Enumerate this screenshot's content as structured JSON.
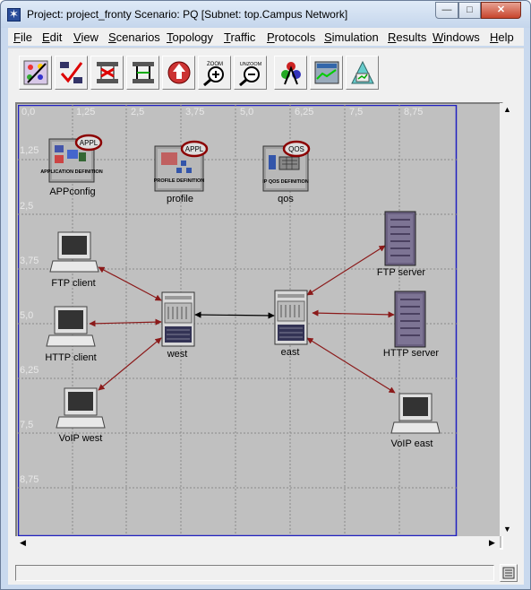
{
  "window": {
    "title": "Project: project_fronty Scenario: PQ  [Subnet: top.Campus Network]",
    "minimize_glyph": "—",
    "maximize_glyph": "□",
    "close_glyph": "✕"
  },
  "menu": [
    {
      "label": "File"
    },
    {
      "label": "Edit"
    },
    {
      "label": "View"
    },
    {
      "label": "Scenarios"
    },
    {
      "label": "Topology"
    },
    {
      "label": "Traffic"
    },
    {
      "label": "Protocols"
    },
    {
      "label": "Simulation"
    },
    {
      "label": "Results"
    },
    {
      "label": "Windows"
    },
    {
      "label": "Help"
    }
  ],
  "toolbar": {
    "buttons": [
      {
        "icon": "object-palette-icon"
      },
      {
        "icon": "check-links-icon"
      },
      {
        "icon": "fail-node-icon"
      },
      {
        "icon": "recover-node-icon"
      },
      {
        "icon": "return-to-parent-icon"
      },
      {
        "icon": "zoom-in-icon",
        "caption": "ZOOM"
      },
      {
        "icon": "zoom-out-icon",
        "caption": "UNZOOM"
      },
      {
        "icon": "configure-simulation-icon"
      },
      {
        "icon": "view-results-icon"
      },
      {
        "icon": "hide-graphs-icon"
      }
    ]
  },
  "canvas": {
    "x_ticks": [
      "0,0",
      "1,25",
      "2,5",
      "3,75",
      "5,0",
      "6,25",
      "7,5",
      "8,75"
    ],
    "y_ticks": [
      "1,25",
      "2,5",
      "3,75",
      "5,0",
      "6,25",
      "7,5",
      "8,75"
    ],
    "colors": {
      "background": "#c0c0c0",
      "grid": "#8a8a8a",
      "border": "#2020c0",
      "link_red": "#8b1a1a",
      "link_black": "#000000"
    },
    "config_nodes": [
      {
        "id": "appconfig",
        "label": "APPconfig",
        "badge": "APPL",
        "caption": "APPLICATION DEFINITION"
      },
      {
        "id": "profile",
        "label": "profile",
        "badge": "APPL",
        "caption": "PROFILE DEFINITION"
      },
      {
        "id": "qos",
        "label": "qos",
        "badge": "QOS",
        "caption": "IP QOS DEFINITION"
      }
    ],
    "workstations": [
      {
        "id": "ftp-client",
        "label": "FTP client"
      },
      {
        "id": "http-client",
        "label": "HTTP client"
      },
      {
        "id": "voip-west",
        "label": "VoIP west"
      },
      {
        "id": "voip-east",
        "label": "VoIP east"
      }
    ],
    "routers": [
      {
        "id": "west",
        "label": "west"
      },
      {
        "id": "east",
        "label": "east"
      }
    ],
    "servers": [
      {
        "id": "ftp-server",
        "label": "FTP server"
      },
      {
        "id": "http-server",
        "label": "HTTP server"
      }
    ]
  },
  "scroll": {
    "up": "▲",
    "down": "▼",
    "left": "◀",
    "right": "▶"
  },
  "status": {
    "text": ""
  }
}
